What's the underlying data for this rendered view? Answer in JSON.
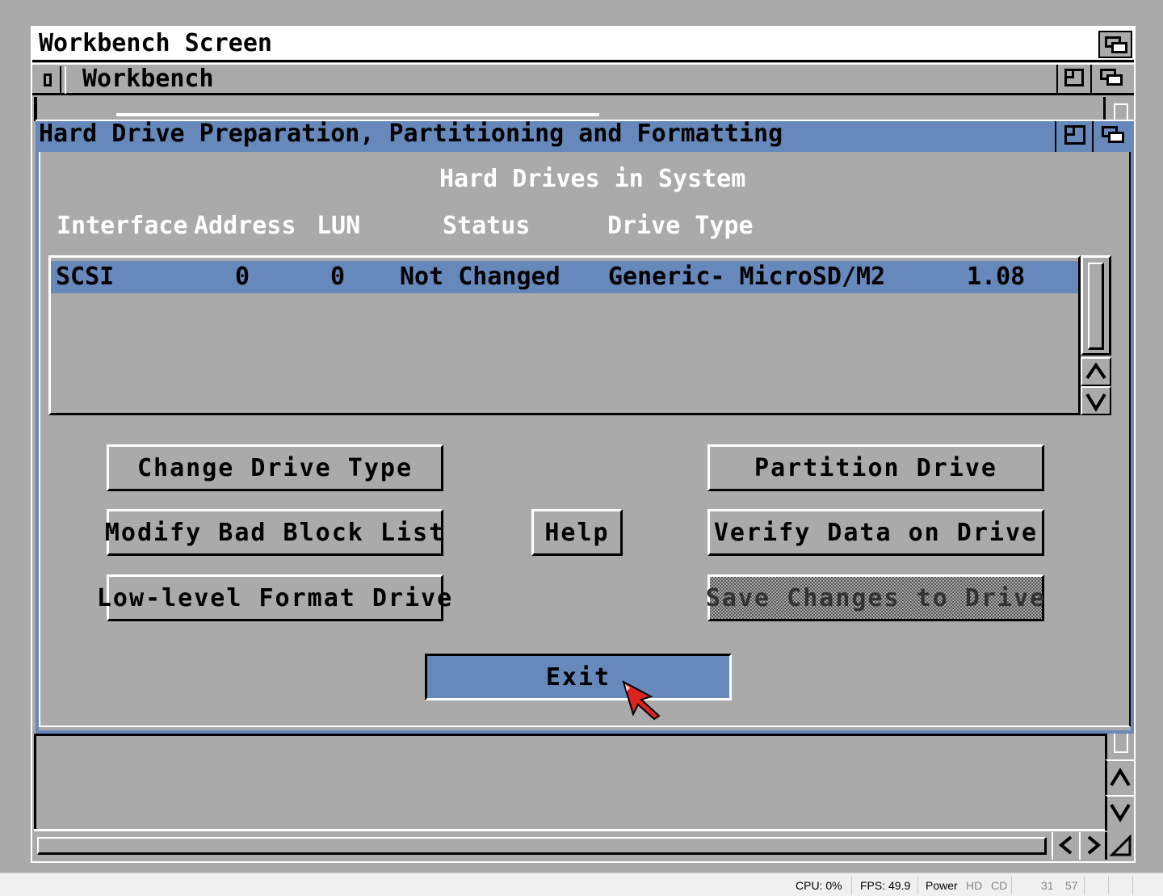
{
  "screen": {
    "title": "Workbench Screen"
  },
  "workbench_window": {
    "title": "Workbench"
  },
  "hdtool_window": {
    "title": "Hard Drive Preparation, Partitioning and Formatting"
  },
  "drives": {
    "heading": "Hard Drives in System",
    "columns": [
      "Interface",
      "Address",
      "LUN",
      "Status",
      "Drive Type"
    ],
    "rows": [
      {
        "interface": "SCSI",
        "address": "0",
        "lun": "0",
        "status": "Not Changed",
        "drive_type": "Generic- MicroSD/M2",
        "revision": "1.08"
      }
    ]
  },
  "buttons": {
    "change_drive_type": "Change Drive Type",
    "modify_bad_block_list": "Modify Bad Block List",
    "low_level_format": "Low-level Format Drive",
    "help": "Help",
    "partition_drive": "Partition Drive",
    "verify_data": "Verify Data on Drive",
    "save_changes": "Save Changes to Drive",
    "exit": "Exit"
  },
  "status_bar": {
    "cpu": "CPU: 0%",
    "fps": "FPS: 49.9",
    "power": "Power",
    "hd": "HD",
    "cd": "CD",
    "num1": "31",
    "num2": "57"
  },
  "colors": {
    "amiga_gray": "#aaaaaa",
    "amiga_blue": "#6688bb",
    "white": "#ffffff",
    "black": "#000000"
  },
  "icons": [
    "depth-gadget-icon",
    "zoom-gadget-icon",
    "close-gadget-icon",
    "arrow-up-icon",
    "arrow-down-icon",
    "arrow-left-icon",
    "arrow-right-icon",
    "resize-icon",
    "mouse-pointer-icon"
  ]
}
